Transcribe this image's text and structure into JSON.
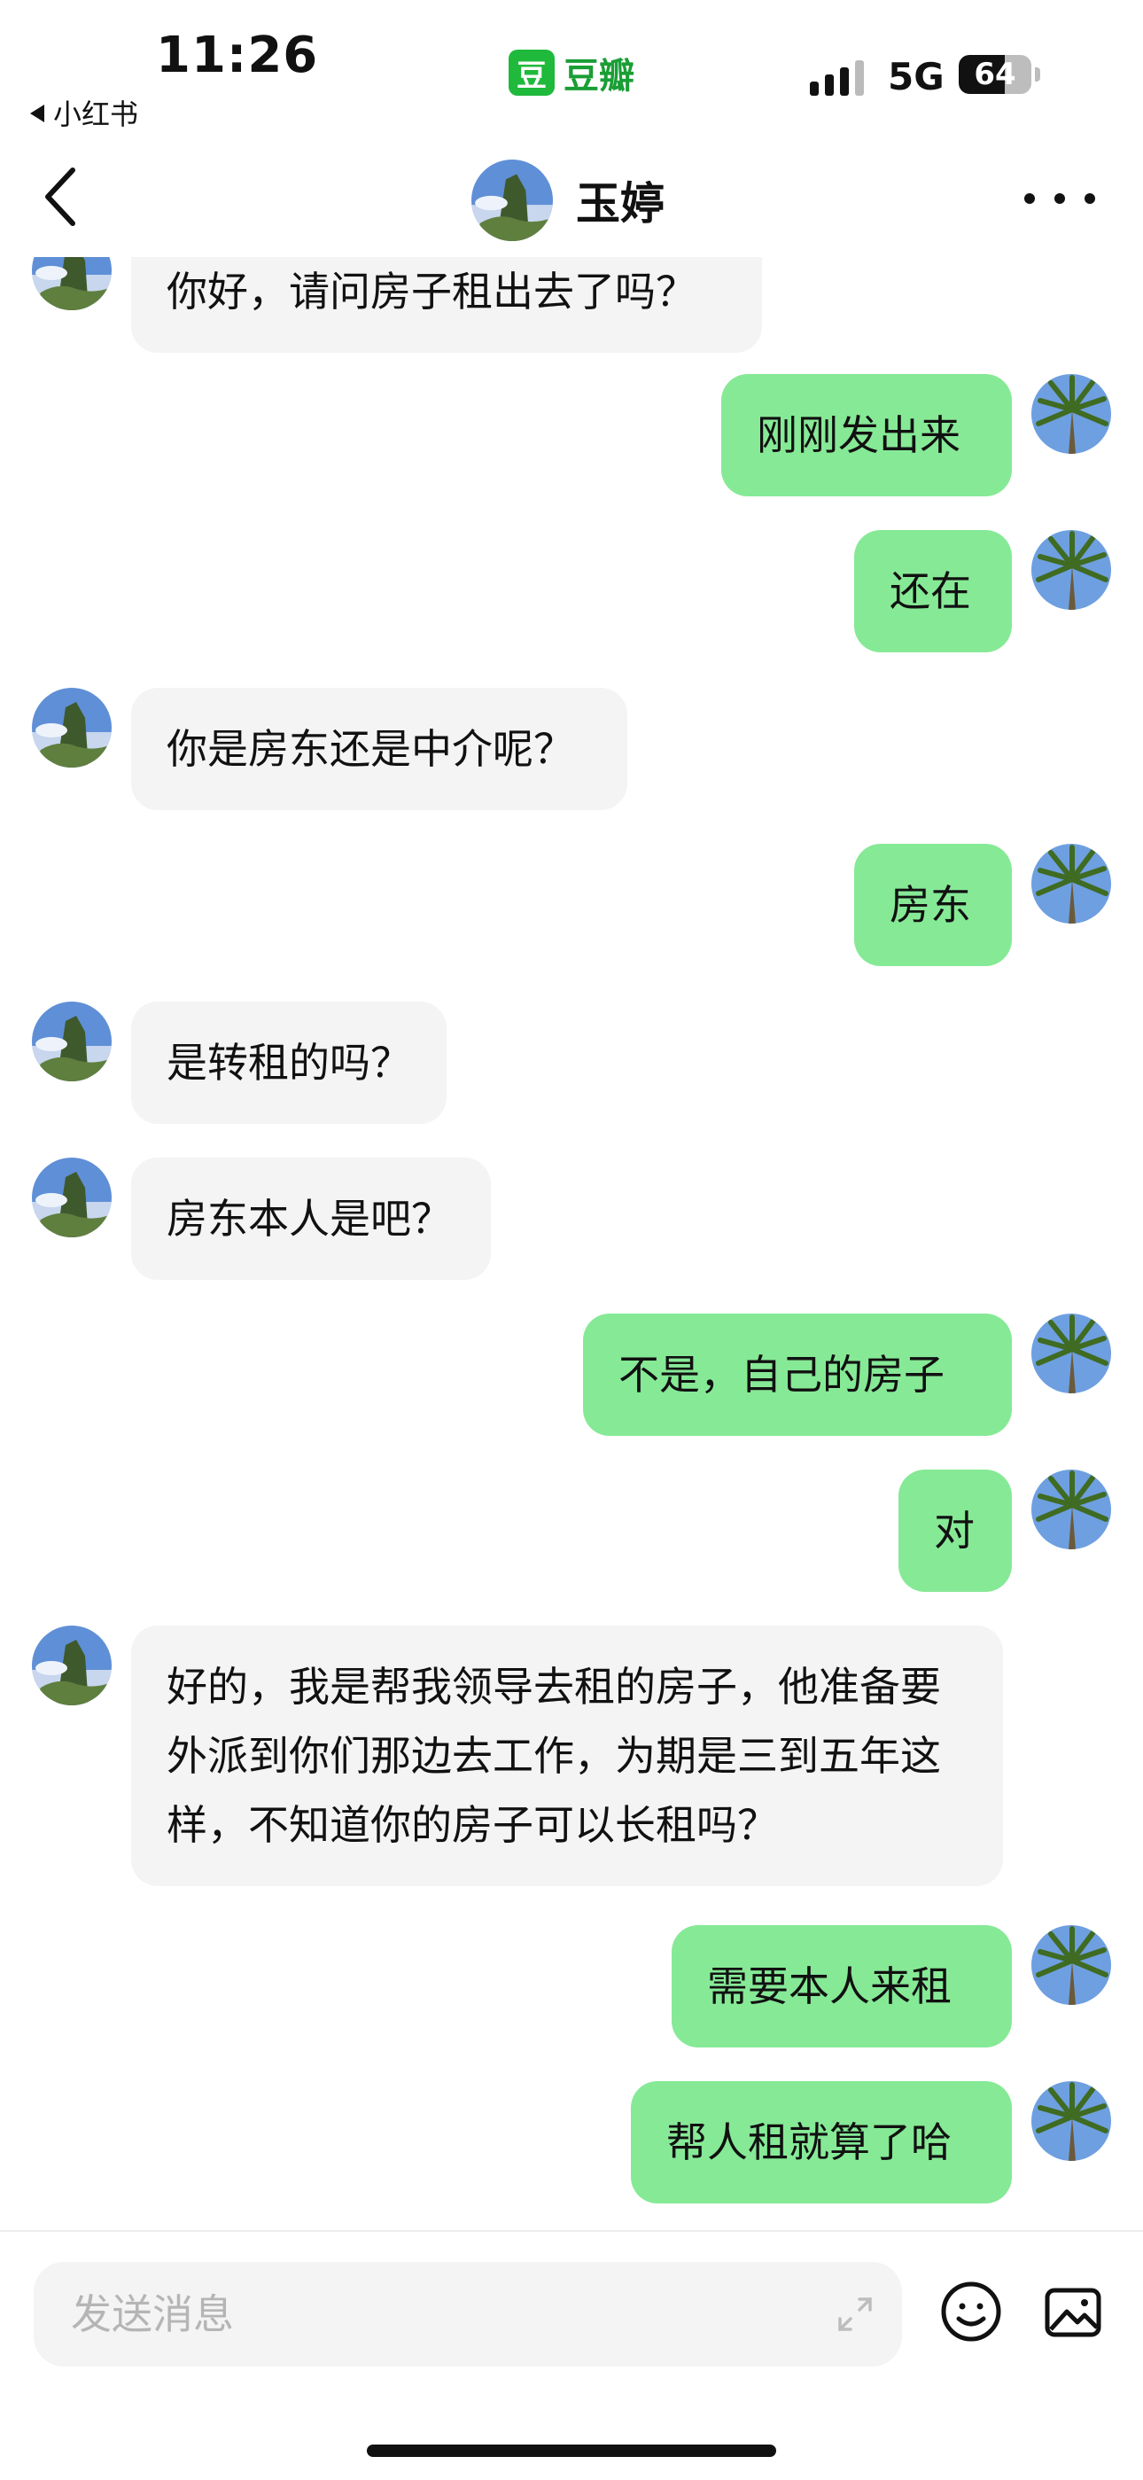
{
  "status_bar": {
    "time": "11:26",
    "back_app": "小红书",
    "app_badge_char": "豆",
    "app_name": "豆瓣",
    "network": "5G",
    "battery": "64",
    "battery_level": 0.64
  },
  "nav": {
    "title": "玉婷",
    "back_icon": "chevron-left-icon",
    "more_icon": "more-dots-icon"
  },
  "messages": [
    {
      "side": "in",
      "text": "你好，请问房子租出去了吗？"
    },
    {
      "side": "out",
      "text": "刚刚发出来"
    },
    {
      "side": "out",
      "text": "还在"
    },
    {
      "side": "in",
      "text": "你是房东还是中介呢？"
    },
    {
      "side": "out",
      "text": "房东"
    },
    {
      "side": "in",
      "text": "是转租的吗？"
    },
    {
      "side": "in",
      "text": "房东本人是吧？"
    },
    {
      "side": "out",
      "text": "不是，自己的房子"
    },
    {
      "side": "out",
      "text": "对"
    },
    {
      "side": "in",
      "text": "好的，我是帮我领导去租的房子，他准备要外派到你们那边去工作，为期是三到五年这样，不知道你的房子可以长租吗？"
    },
    {
      "side": "out",
      "text": "需要本人来租"
    },
    {
      "side": "out",
      "text": "帮人租就算了哈"
    }
  ],
  "input": {
    "placeholder": "发送消息",
    "value": "",
    "expand_icon": "expand-icon",
    "emoji_icon": "emoji-icon",
    "image_icon": "image-icon"
  },
  "colors": {
    "outgoing_bubble": "#86e996",
    "incoming_bubble": "#f4f4f4",
    "brand_green": "#1fb93c"
  }
}
